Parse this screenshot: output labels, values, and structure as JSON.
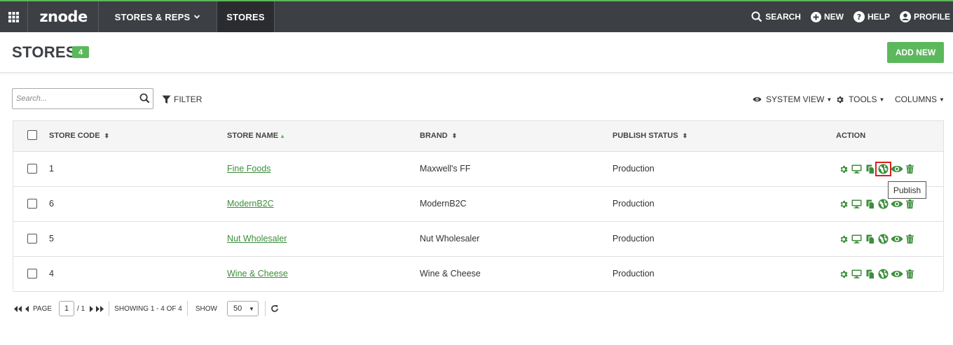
{
  "nav": {
    "logo": "znode",
    "stores_reps": "STORES & REPS",
    "stores": "STORES",
    "search": "SEARCH",
    "new": "NEW",
    "help": "HELP",
    "profile": "PROFILE"
  },
  "header": {
    "title": "STORES",
    "count": "4",
    "add_new": "ADD NEW"
  },
  "toolbar": {
    "search_placeholder": "Search...",
    "filter": "FILTER",
    "system_view": "SYSTEM VIEW",
    "tools": "TOOLS",
    "columns": "COLUMNS"
  },
  "table": {
    "columns": [
      "STORE CODE",
      "STORE NAME",
      "BRAND",
      "PUBLISH STATUS",
      "ACTION"
    ],
    "rows": [
      {
        "code": "1",
        "name": "Fine Foods",
        "brand": "Maxwell's FF",
        "status": "Production"
      },
      {
        "code": "6",
        "name": "ModernB2C",
        "brand": "ModernB2C",
        "status": "Production"
      },
      {
        "code": "5",
        "name": "Nut Wholesaler",
        "brand": "Nut Wholesaler",
        "status": "Production"
      },
      {
        "code": "4",
        "name": "Wine & Cheese",
        "brand": "Wine & Cheese",
        "status": "Production"
      }
    ],
    "action_icons": [
      "gear-icon",
      "monitor-icon",
      "copy-icon",
      "globe-icon",
      "eye-icon",
      "trash-icon"
    ]
  },
  "tooltip": "Publish",
  "pager": {
    "page_label": "PAGE",
    "page": "1",
    "of": "/ 1",
    "showing": "SHOWING 1 - 4 OF 4",
    "show_label": "SHOW",
    "page_size": "50"
  },
  "colors": {
    "accent": "#5cb85c",
    "nav_bg": "#3c3f43",
    "icon_green": "#3d8e3d",
    "highlight": "#d9201c"
  }
}
